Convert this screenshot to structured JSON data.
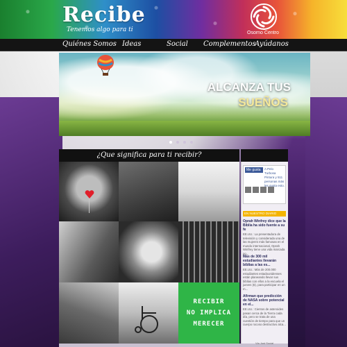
{
  "header": {
    "title": "Recibe",
    "tagline": "Tenemos algo para ti",
    "brand_name": "Osorno Centro",
    "logo_icon": "swirl-logo-icon"
  },
  "nav": {
    "items": [
      {
        "label": "Quiénes Somos"
      },
      {
        "label": "Ideas"
      },
      {
        "label": "Social"
      },
      {
        "label": "Complementos"
      },
      {
        "label": "Ayúdanos"
      }
    ]
  },
  "banner": {
    "line1": "ALCANZA TUS",
    "line2": "SUEÑOS",
    "balloon_icon": "hot-air-balloon-icon"
  },
  "slider": {
    "dot_count": 4,
    "active_index": 0
  },
  "main": {
    "heading": "¿Que significa para ti recibir?",
    "quote": [
      "RECIBIR",
      "NO IMPLICA",
      "MERECER"
    ],
    "quote_color": "#2fb547"
  },
  "sidebar": {
    "facebook": {
      "like_label": "Me gusta",
      "page_text": "A Pelo Turbosa Pintura y 511 personas más les gusta esto."
    },
    "news_header": "EN NUESTRO DIARIO",
    "news": [
      {
        "title": "Oprah Winfrey dice que la Biblia ha sido fuente a su fe",
        "body": "EE.UU.: La presentadora de televisión y considerada una de las mujeres más famosas en el mundo internacional, Oprah Winfrey tiene una vida marcada po..."
      },
      {
        "title": "Más de 300 mil estudiantes llevarán biblias a las es...",
        "body": "EE.UU.: Más de 200.000 estudiantes estadounidenses están planeando llevar sus biblias con ellos a la escuela el jueves (6), para participar en un m..."
      },
      {
        "title": "Afirman que predicción de NASA sobre potencial en el...",
        "body": "EE.UU.: Cientos de asteroides pasan cerca de la Tierra cada día, pero se trata de una cuestión de tiempo para que un cuerpo rocoso destructivo alca..."
      }
    ],
    "footer": "Via Just Social"
  },
  "colors": {
    "nav_bg": "#141414",
    "accent_green": "#2fb547",
    "news_header": "#f4b400"
  }
}
